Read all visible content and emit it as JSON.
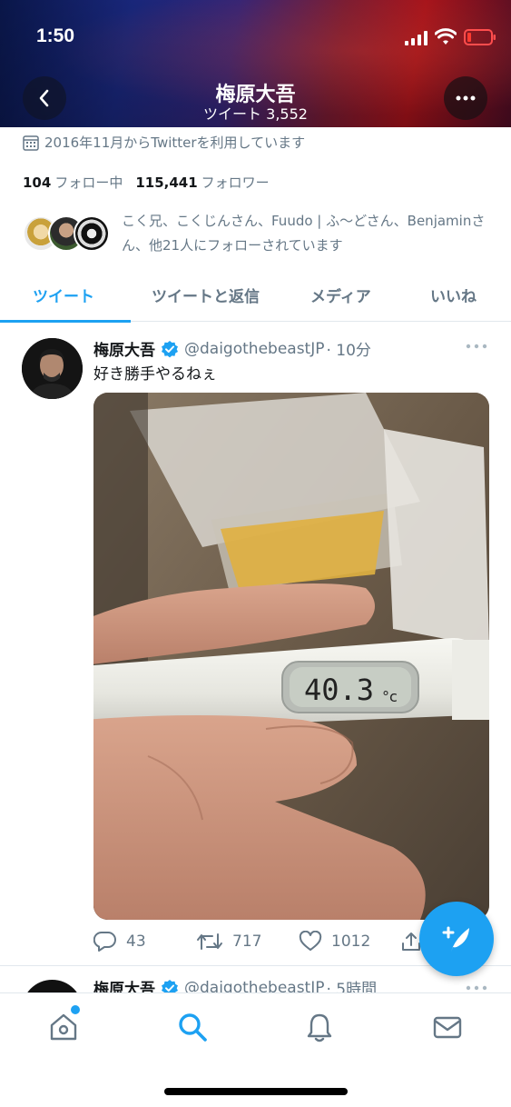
{
  "status_bar": {
    "time": "1:50"
  },
  "header": {
    "title": "梅原大吾",
    "subtitle": "ツイート 3,552"
  },
  "profile": {
    "joined": "2016年11月からTwitterを利用しています",
    "following_count": "104",
    "following_label": "フォロー中",
    "followers_count": "115,441",
    "followers_label": "フォロワー",
    "followed_by": "こく兄、こくじんさん、Fuudo | ふ〜どさん、Benjaminさん、他21人にフォローされています"
  },
  "tabs": [
    {
      "label": "ツイート",
      "active": true
    },
    {
      "label": "ツイートと返信",
      "active": false
    },
    {
      "label": "メディア",
      "active": false
    },
    {
      "label": "いいね",
      "active": false
    }
  ],
  "tweet": {
    "name": "梅原大吾",
    "handle": "@daigothebeastJP",
    "time": "· 10分",
    "text": "好き勝手やるねぇ",
    "photo_reading": "40.3",
    "photo_unit": "°c",
    "replies": "43",
    "retweets": "717",
    "likes": "1012"
  },
  "tweet2": {
    "name": "梅原大吾",
    "handle": "@daigothebeastJP",
    "time": "· 5時間"
  },
  "icons": {
    "accent": "#1da1f2",
    "verified": "verified-badge-icon"
  }
}
